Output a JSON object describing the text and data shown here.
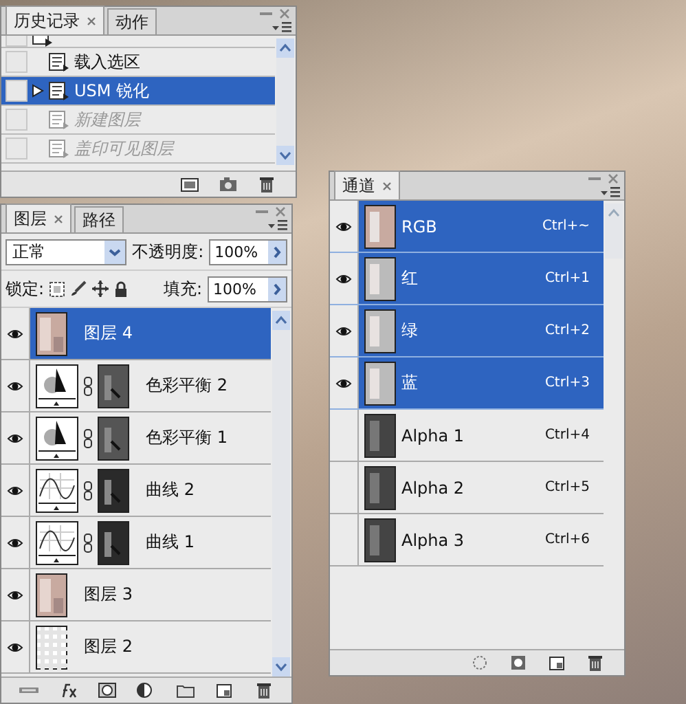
{
  "history": {
    "tabs": [
      {
        "label": "历史记录",
        "selected": true,
        "closable": true
      },
      {
        "label": "动作",
        "selected": false,
        "closable": false
      }
    ],
    "items": [
      {
        "label": "载入选区",
        "selected": false,
        "dimmed": false
      },
      {
        "label": "USM 锐化",
        "selected": true,
        "dimmed": false
      },
      {
        "label": "新建图层",
        "selected": false,
        "dimmed": true
      },
      {
        "label": "盖印可见图层",
        "selected": false,
        "dimmed": true
      }
    ]
  },
  "layers": {
    "tabs": [
      {
        "label": "图层",
        "selected": true,
        "closable": true
      },
      {
        "label": "路径",
        "selected": false,
        "closable": false
      }
    ],
    "blend_mode": "正常",
    "opacity_label": "不透明度:",
    "opacity": "100%",
    "lock_label": "锁定:",
    "fill_label": "填充:",
    "fill": "100%",
    "items": [
      {
        "name": "图层 4",
        "kind": "image",
        "visible": true,
        "selected": true
      },
      {
        "name": "色彩平衡 2",
        "kind": "balance",
        "visible": true,
        "selected": false
      },
      {
        "name": "色彩平衡 1",
        "kind": "balance",
        "visible": true,
        "selected": false
      },
      {
        "name": "曲线 2",
        "kind": "curves",
        "visible": true,
        "selected": false
      },
      {
        "name": "曲线 1",
        "kind": "curves",
        "visible": true,
        "selected": false
      },
      {
        "name": "图层 3",
        "kind": "image",
        "visible": true,
        "selected": false
      },
      {
        "name": "图层 2",
        "kind": "empty",
        "visible": true,
        "selected": false
      }
    ]
  },
  "channels": {
    "tabs": [
      {
        "label": "通道",
        "selected": true,
        "closable": true
      }
    ],
    "items": [
      {
        "name": "RGB",
        "shortcut": "Ctrl+~",
        "visible": true,
        "selected": true
      },
      {
        "name": "红",
        "shortcut": "Ctrl+1",
        "visible": true,
        "selected": true
      },
      {
        "name": "绿",
        "shortcut": "Ctrl+2",
        "visible": true,
        "selected": true
      },
      {
        "name": "蓝",
        "shortcut": "Ctrl+3",
        "visible": true,
        "selected": true
      },
      {
        "name": "Alpha 1",
        "shortcut": "Ctrl+4",
        "visible": false,
        "selected": false
      },
      {
        "name": "Alpha 2",
        "shortcut": "Ctrl+5",
        "visible": false,
        "selected": false
      },
      {
        "name": "Alpha 3",
        "shortcut": "Ctrl+6",
        "visible": false,
        "selected": false
      }
    ]
  }
}
